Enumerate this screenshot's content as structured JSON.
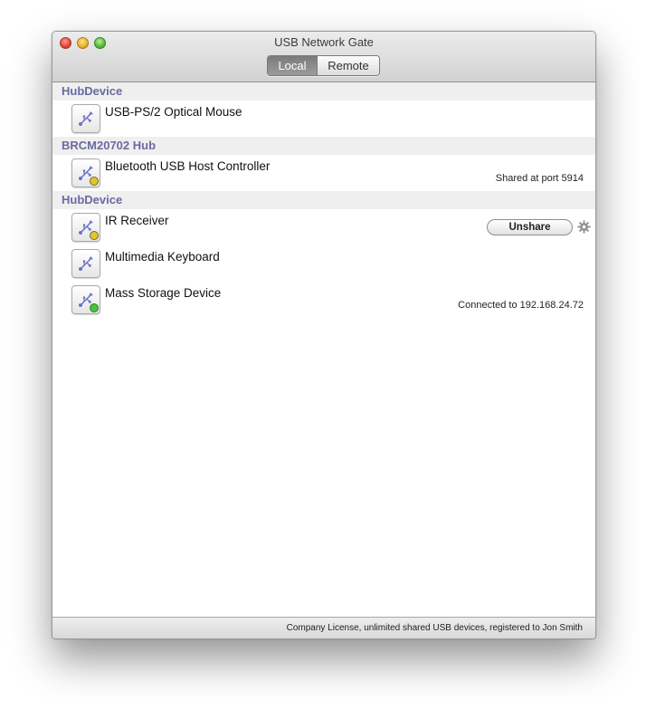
{
  "window": {
    "title": "USB Network Gate"
  },
  "tabs": [
    {
      "label": "Local",
      "selected": true
    },
    {
      "label": "Remote",
      "selected": false
    }
  ],
  "groups": [
    {
      "header": "HubDevice",
      "devices": [
        {
          "name": "USB-PS/2 Optical Mouse",
          "status": "",
          "indicator": "none"
        }
      ]
    },
    {
      "header": "BRCM20702 Hub",
      "devices": [
        {
          "name": "Bluetooth USB Host Controller",
          "status": "Shared at port 5914",
          "indicator": "yellow"
        }
      ]
    },
    {
      "header": "HubDevice",
      "devices": [
        {
          "name": "IR Receiver",
          "status": "",
          "indicator": "yellow",
          "action_label": "Unshare",
          "action_icon": "gear-icon"
        },
        {
          "name": "Multimedia Keyboard",
          "status": "",
          "indicator": "none"
        },
        {
          "name": "Mass Storage Device",
          "status": "Connected to 192.168.24.72",
          "indicator": "green"
        }
      ]
    }
  ],
  "statusbar": {
    "text": "Company License, unlimited shared USB devices, registered to Jon Smith"
  },
  "colors": {
    "group_header_text": "#6a6aa0",
    "indicator_yellow": "#e5c42c",
    "indicator_green": "#46c43a"
  }
}
